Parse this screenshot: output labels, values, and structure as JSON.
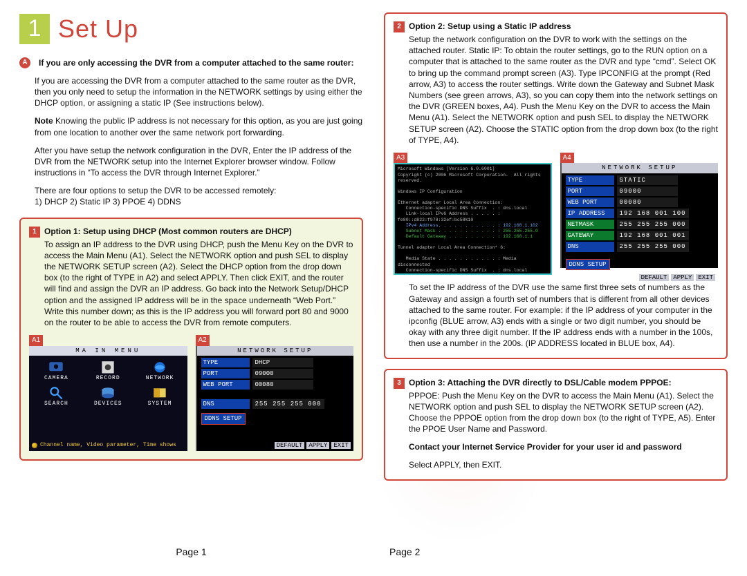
{
  "page1": {
    "chapter_num": "1",
    "chapter_title": "Set Up",
    "sectionA": {
      "marker": "A",
      "title": "If you are only accessing the DVR from a computer attached to the same router:",
      "p1": "If you are accessing the DVR from a computer attached to the same router as the DVR, then you only need to setup the information in the NETWORK settings by using either the DHCP option, or assigning a static IP (See instructions below).",
      "note_label": "Note",
      "note": "Knowing the public IP address is not necessary for this option, as you are just going from one location to another over the same network port forwarding.",
      "p2": "After you have setup the network configuration in the DVR, Enter the IP address of the DVR from the NETWORK setup into the Internet Explorer browser window. Follow instructions in “To access the DVR through Internet Explorer.”",
      "p3": "There are four options to setup the DVR to be accessed remotely:",
      "p3b": "1) DHCP 2) Static IP 3) PPOE 4) DDNS"
    },
    "option1": {
      "marker": "1",
      "title": "Option 1:  Setup using DHCP (Most common routers are DHCP)",
      "body": "To assign an IP address to the DVR using DHCP, push the Menu Key on the DVR to access the Main Menu (A1). Select the NETWORK option and push SEL to display the NETWORK SETUP screen (A2). Select the DHCP option from the drop down box (to the right of TYPE in A2) and select APPLY. Then click EXIT, and the router will find and assign the DVR an IP address.  Go back into the Network Setup/DHCP option and the assigned IP address will be in the space underneath “Web Port.” Write this number down; as this is the IP address you will forward port 80 and 9000 on the router to be able to access the DVR from remote computers.",
      "a1_tag": "A1",
      "a2_tag": "A2",
      "mainmenu_title": "MA IN   MENU",
      "mm_items": [
        "CAMERA",
        "RECORD",
        "NETWORK",
        "SEARCH",
        "DEVICES",
        "SYSTEM"
      ],
      "mm_footer": "Channel name, Video parameter, Time shows",
      "ns_title": "NETWORK  SETUP",
      "ns_rows": [
        {
          "label": "TYPE",
          "val": "DHCP"
        },
        {
          "label": "PORT",
          "val": "09000"
        },
        {
          "label": "WEB  PORT",
          "val": "00080"
        }
      ],
      "ns_dns_label": "DNS",
      "ns_dns_val": "255 255 255 000",
      "ddns": "DDNS SETUP",
      "ns_buttons": [
        "DEFAULT",
        "APPLY",
        "EXIT"
      ]
    },
    "footer": "Page 1"
  },
  "page2": {
    "option2": {
      "marker": "2",
      "title": "Option 2:  Setup using a Static IP address",
      "body": "Setup the network configuration on the DVR to work with the settings on the attached router. Static IP: To obtain the router settings, go to the RUN option on a computer that is attached to the same router as the DVR and type “cmd”. Select OK to bring up the command prompt screen (A3).  Type IPCONFIG at the prompt (Red arrow, A3) to access the router settings. Write down the Gateway and Subnet Mask Numbers (see green arrows, A3), so you can copy them into the network settings on the DVR (GREEN boxes, A4). Push the Menu Key on the DVR to access the Main Menu (A1). Select the NETWORK option and push SEL to display the NETWORK SETUP screen (A2). Choose the STATIC option from the drop down box (to the right of TYPE, A4).",
      "a3_tag": "A3",
      "a4_tag": "A4",
      "cmd_lines": "Microsoft Windows [Version 6.0.6001]\nCopyright (c) 2006 Microsoft Corporation.  All rights reserved.\n\nWindows IP Configuration\n\nEthernet adapter Local Area Connection:\n   Connection-specific DNS Suffix  . : dns.local\n   Link-local IPv6 Address . . . . . : fe80::d822:f978:32ef:bc58%10\n   IPv4 Address. . . . . . . . . . . : 192.168.1.102\n   Subnet Mask . . . . . . . . . . . : 255.255.255.0\n   Default Gateway . . . . . . . . . : 192.168.1.1\n\nTunnel adapter Local Area Connection* 6:\n\n   Media State . . . . . . . . . . . : Media disconnected\n   Connection-specific DNS Suffix  . : dns.local",
      "ns_title": "NETWORK  SETUP",
      "ns_rows_a4": [
        {
          "label": "TYPE",
          "val": "STATIC",
          "cls": ""
        },
        {
          "label": "PORT",
          "val": "09000",
          "cls": ""
        },
        {
          "label": "WEB  PORT",
          "val": "00080",
          "cls": ""
        },
        {
          "label": "IP ADDRESS",
          "val": "192 168 001 100",
          "cls": ""
        },
        {
          "label": "NETMASK",
          "val": "255 255 255 000",
          "cls": "green"
        },
        {
          "label": "GATEWAY",
          "val": "192 168 001 001",
          "cls": "green"
        },
        {
          "label": "DNS",
          "val": "255 255 255 000",
          "cls": ""
        }
      ],
      "ddns": "DDNS SETUP",
      "ns_buttons": [
        "DEFAULT",
        "APPLY",
        "EXIT"
      ],
      "body2": "To set the IP address of the DVR use the same first three sets of numbers as the Gateway and assign a fourth set of numbers that is different from all other devices attached to the same router. For example: if the IP address of your computer in the ipconfig (BLUE arrow, A3) ends with a single or two digit number, you should be okay with any three digit number. If the IP address ends with a number in the 100s, then use a number in the 200s. (IP ADDRESS located in BLUE box, A4)."
    },
    "option3": {
      "marker": "3",
      "title": "Option 3:  Attaching the DVR directly to DSL/Cable modem PPPOE:",
      "body": "PPPOE: Push the Menu Key on the DVR to access the Main Menu (A1). Select the NETWORK option and push SEL to display the NETWORK SETUP screen (A2). Choose the PPPOE option from the drop down box (to the right of TYPE, A5). Enter the PPOE User Name and Password.",
      "contact": "Contact your Internet Service Provider for your user id and password",
      "final": "Select APPLY, then EXIT."
    },
    "footer": "Page 2"
  }
}
